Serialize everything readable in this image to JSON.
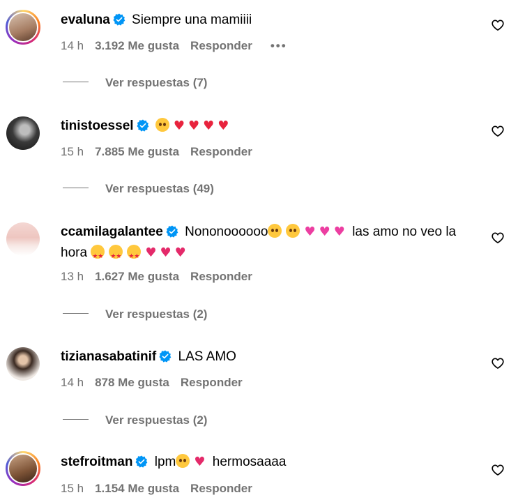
{
  "comments": [
    {
      "username": "evaluna",
      "text": "Siempre una mamiiii",
      "time": "14 h",
      "likes": "3.192 Me gusta",
      "reply_label": "Responder",
      "more": "•••",
      "view_replies": "Ver respuestas (7)"
    },
    {
      "username": "tinistoessel",
      "text": "",
      "time": "15 h",
      "likes": "7.885 Me gusta",
      "reply_label": "Responder",
      "view_replies": "Ver respuestas (49)"
    },
    {
      "username": "ccamilagalantee",
      "text_a": "Nononoooooo",
      "text_b": "las amo no veo la hora",
      "time": "13 h",
      "likes": "1.627 Me gusta",
      "reply_label": "Responder",
      "view_replies": "Ver respuestas (2)"
    },
    {
      "username": "tizianasabatinif",
      "text": "LAS AMO",
      "time": "14 h",
      "likes": "878 Me gusta",
      "reply_label": "Responder",
      "view_replies": "Ver respuestas (2)"
    },
    {
      "username": "stefroitman",
      "text_a": "lpm",
      "text_b": "hermosaaaa",
      "time": "15 h",
      "likes": "1.154 Me gusta",
      "reply_label": "Responder"
    }
  ],
  "emojis": {
    "hearts": "♥♥♥♥",
    "pink_hearts": "♥♥♥",
    "sparkle_hearts": "♥♥♥",
    "arrow_heart": "♥"
  },
  "colors": {
    "verified": "#0095f6",
    "meta_text": "#737373",
    "heart_red": "#e8233d",
    "heart_pink": "#ec3ea1"
  },
  "icons": {
    "verified": "verified-badge-icon",
    "like": "heart-outline-icon",
    "more": "more-options-icon"
  }
}
